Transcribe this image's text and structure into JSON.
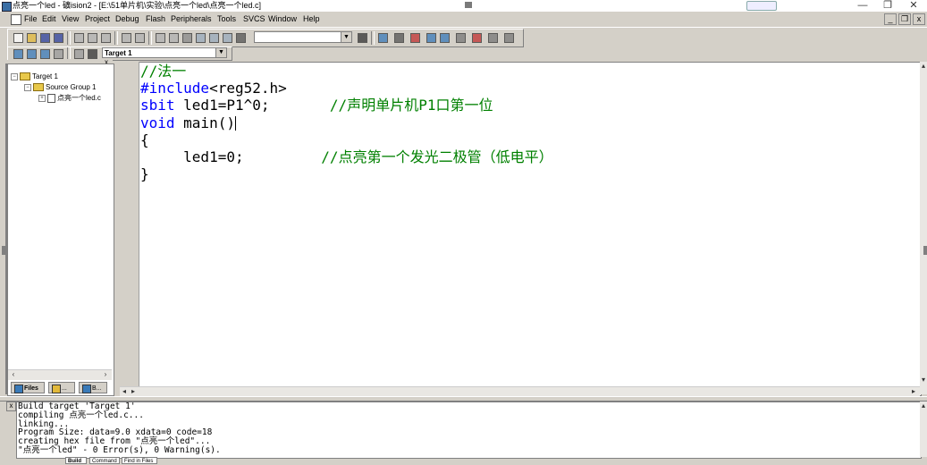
{
  "window": {
    "title": "点亮一个led - 礦ision2 - [E:\\51单片机\\实验\\点亮一个led\\点亮一个led.c]",
    "minimize": "—",
    "restore": "❐",
    "close": "✕"
  },
  "menubar": {
    "items": [
      "File",
      "Edit",
      "View",
      "Project",
      "Debug",
      "Flash",
      "Peripherals",
      "Tools",
      "SVCS",
      "Window",
      "Help"
    ],
    "mdi_min": "_",
    "mdi_restore": "❐",
    "mdi_close": "x"
  },
  "toolbar": {
    "find_combo_value": "",
    "target_combo_value": "Target 1"
  },
  "project": {
    "tree": {
      "target": "Target 1",
      "group": "Source Group 1",
      "file": "点亮一个led.c"
    },
    "tabs": [
      "Files",
      "...",
      "B..."
    ],
    "close": "x"
  },
  "editor": {
    "lines": [
      [
        {
          "t": "//法一",
          "c": "cm"
        }
      ],
      [
        {
          "t": "#include",
          "c": "kw"
        },
        {
          "t": "<reg52.h>",
          "c": ""
        }
      ],
      [
        {
          "t": "sbit",
          "c": "kw"
        },
        {
          "t": " led1=P1^0;       ",
          "c": ""
        },
        {
          "t": "//声明单片机P1口第一位",
          "c": "cm"
        }
      ],
      [
        {
          "t": "void",
          "c": "kw"
        },
        {
          "t": " main()",
          "c": ""
        }
      ],
      [
        {
          "t": "{",
          "c": ""
        }
      ],
      [
        {
          "t": "     led1=0;         ",
          "c": ""
        },
        {
          "t": "//点亮第一个发光二极管（低电平）",
          "c": "cm"
        }
      ],
      [
        {
          "t": "}",
          "c": ""
        }
      ]
    ]
  },
  "output": {
    "lines": [
      "Build target 'Target 1'",
      "compiling 点亮一个led.c...",
      "linking...",
      "Program Size: data=9.0 xdata=0 code=18",
      "creating hex file from \"点亮一个led\"...",
      "\"点亮一个led\" - 0 Error(s), 0 Warning(s)."
    ],
    "tabs": [
      "Build",
      "Command",
      "Find in Files"
    ],
    "close": "x"
  }
}
